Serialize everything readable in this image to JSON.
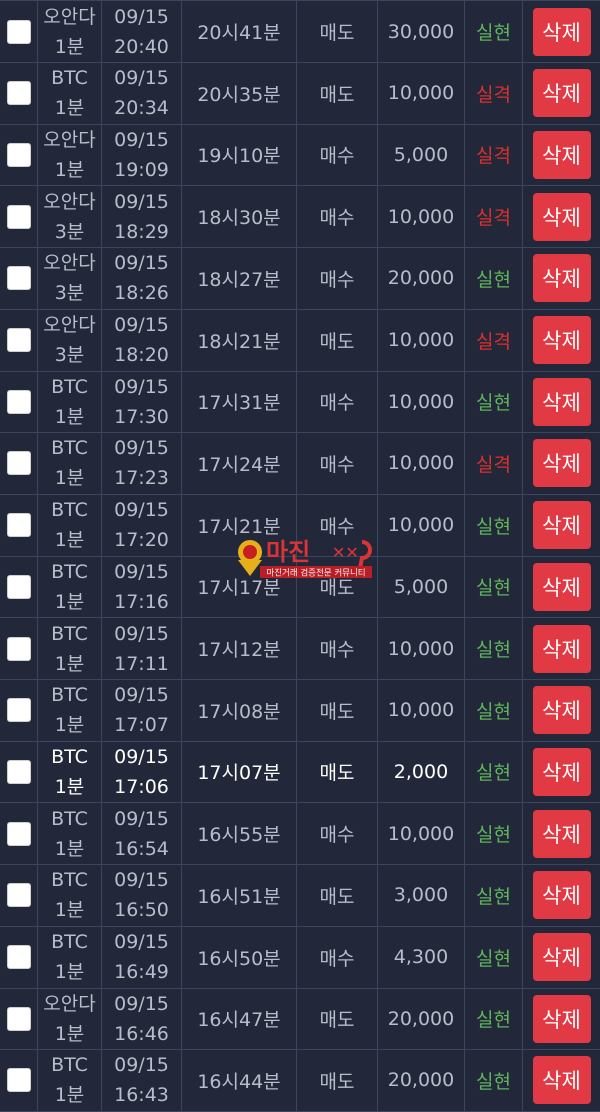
{
  "colors": {
    "background": "#222839",
    "border": "#3c4560",
    "win_text": "#5fb45c",
    "loss_text": "#d8312e",
    "delete_button": "#e13a45"
  },
  "rows": [
    {
      "game_name": "오안다",
      "game_interval": "1분",
      "date": "09/15",
      "time": "20:40",
      "round": "20시41분",
      "side": "매도",
      "amount": "30,000",
      "result": "실현",
      "result_type": "win",
      "delete_label": "삭제"
    },
    {
      "game_name": "BTC",
      "game_interval": "1분",
      "date": "09/15",
      "time": "20:34",
      "round": "20시35분",
      "side": "매도",
      "amount": "10,000",
      "result": "실격",
      "result_type": "loss",
      "delete_label": "삭제"
    },
    {
      "game_name": "오안다",
      "game_interval": "1분",
      "date": "09/15",
      "time": "19:09",
      "round": "19시10분",
      "side": "매수",
      "amount": "5,000",
      "result": "실격",
      "result_type": "loss",
      "delete_label": "삭제"
    },
    {
      "game_name": "오안다",
      "game_interval": "3분",
      "date": "09/15",
      "time": "18:29",
      "round": "18시30분",
      "side": "매수",
      "amount": "10,000",
      "result": "실격",
      "result_type": "loss",
      "delete_label": "삭제"
    },
    {
      "game_name": "오안다",
      "game_interval": "3분",
      "date": "09/15",
      "time": "18:26",
      "round": "18시27분",
      "side": "매수",
      "amount": "20,000",
      "result": "실현",
      "result_type": "win",
      "delete_label": "삭제"
    },
    {
      "game_name": "오안다",
      "game_interval": "3분",
      "date": "09/15",
      "time": "18:20",
      "round": "18시21분",
      "side": "매도",
      "amount": "10,000",
      "result": "실격",
      "result_type": "loss",
      "delete_label": "삭제"
    },
    {
      "game_name": "BTC",
      "game_interval": "1분",
      "date": "09/15",
      "time": "17:30",
      "round": "17시31분",
      "side": "매수",
      "amount": "10,000",
      "result": "실현",
      "result_type": "win",
      "delete_label": "삭제"
    },
    {
      "game_name": "BTC",
      "game_interval": "1분",
      "date": "09/15",
      "time": "17:23",
      "round": "17시24분",
      "side": "매수",
      "amount": "10,000",
      "result": "실격",
      "result_type": "loss",
      "delete_label": "삭제"
    },
    {
      "game_name": "BTC",
      "game_interval": "1분",
      "date": "09/15",
      "time": "17:20",
      "round": "17시21분",
      "side": "매수",
      "amount": "10,000",
      "result": "실현",
      "result_type": "win",
      "delete_label": "삭제"
    },
    {
      "game_name": "BTC",
      "game_interval": "1분",
      "date": "09/15",
      "time": "17:16",
      "round": "17시17분",
      "side": "매도",
      "amount": "5,000",
      "result": "실현",
      "result_type": "win",
      "delete_label": "삭제"
    },
    {
      "game_name": "BTC",
      "game_interval": "1분",
      "date": "09/15",
      "time": "17:11",
      "round": "17시12분",
      "side": "매수",
      "amount": "10,000",
      "result": "실현",
      "result_type": "win",
      "delete_label": "삭제"
    },
    {
      "game_name": "BTC",
      "game_interval": "1분",
      "date": "09/15",
      "time": "17:07",
      "round": "17시08분",
      "side": "매도",
      "amount": "10,000",
      "result": "실현",
      "result_type": "win",
      "delete_label": "삭제"
    },
    {
      "game_name": "BTC",
      "game_interval": "1분",
      "date": "09/15",
      "time": "17:06",
      "round": "17시07분",
      "side": "매도",
      "amount": "2,000",
      "result": "실현",
      "result_type": "win",
      "delete_label": "삭제",
      "highlight": true
    },
    {
      "game_name": "BTC",
      "game_interval": "1분",
      "date": "09/15",
      "time": "16:54",
      "round": "16시55분",
      "side": "매수",
      "amount": "10,000",
      "result": "실현",
      "result_type": "win",
      "delete_label": "삭제"
    },
    {
      "game_name": "BTC",
      "game_interval": "1분",
      "date": "09/15",
      "time": "16:50",
      "round": "16시51분",
      "side": "매도",
      "amount": "3,000",
      "result": "실현",
      "result_type": "win",
      "delete_label": "삭제"
    },
    {
      "game_name": "BTC",
      "game_interval": "1분",
      "date": "09/15",
      "time": "16:49",
      "round": "16시50분",
      "side": "매수",
      "amount": "4,300",
      "result": "실현",
      "result_type": "win",
      "delete_label": "삭제"
    },
    {
      "game_name": "오안다",
      "game_interval": "1분",
      "date": "09/15",
      "time": "16:46",
      "round": "16시47분",
      "side": "매도",
      "amount": "20,000",
      "result": "실현",
      "result_type": "win",
      "delete_label": "삭제"
    },
    {
      "game_name": "BTC",
      "game_interval": "1분",
      "date": "09/15",
      "time": "16:43",
      "round": "16시44분",
      "side": "매도",
      "amount": "20,000",
      "result": "실현",
      "result_type": "win",
      "delete_label": "삭제"
    }
  ],
  "watermark": {
    "title": "마진",
    "subtitle": "마진거래 검증전문 커뮤니티"
  }
}
